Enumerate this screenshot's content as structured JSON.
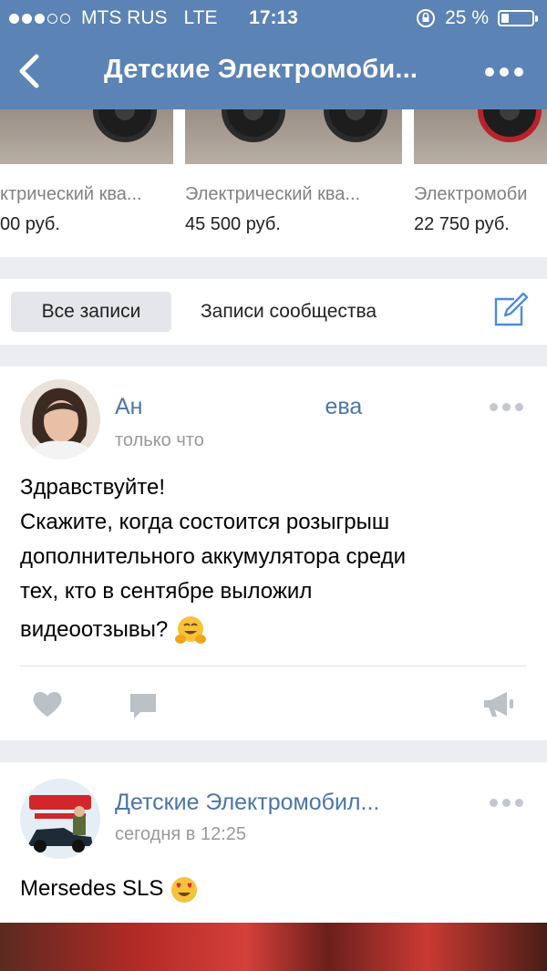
{
  "status_bar": {
    "carrier": "MTS RUS",
    "network": "LTE",
    "time": "17:13",
    "battery": "25 %",
    "battery_level": 0.25,
    "signal_bars_filled": 3,
    "signal_bars_total": 5
  },
  "nav": {
    "title": "Детские Электромоби...",
    "back_icon": "chevron-left-icon",
    "more_icon": "more-horizontal-icon"
  },
  "products": [
    {
      "name": "ктрический ква...",
      "price": "00 руб."
    },
    {
      "name": "Электрический ква...",
      "price": "45 500 руб."
    },
    {
      "name": "Электромоби",
      "price": "22 750 руб."
    }
  ],
  "tabs": {
    "all": "Все записи",
    "community": "Записи сообщества",
    "edit_icon": "edit-post-icon"
  },
  "posts": [
    {
      "author_start": "Ан",
      "author_end": "ева",
      "time_start": "только что",
      "text_lines": [
        "Здравствуйте!",
        "Скажите, когда состоится розыгрыш",
        "дополнительного аккумулятора среди",
        "тех, кто в сентябре выложил",
        "видеоотзывы?"
      ],
      "emoji": "hugging-face-emoji",
      "actions": [
        "like-icon",
        "comment-icon",
        "share-icon"
      ]
    },
    {
      "author": "Детские Электромобил...",
      "time": "сегодня в 12:25",
      "text": "Mersedes SLS",
      "emoji": "heart-eyes-emoji"
    }
  ],
  "colors": {
    "header": "#5c83b5",
    "link": "#4a76a8",
    "background": "#ebedf0"
  }
}
